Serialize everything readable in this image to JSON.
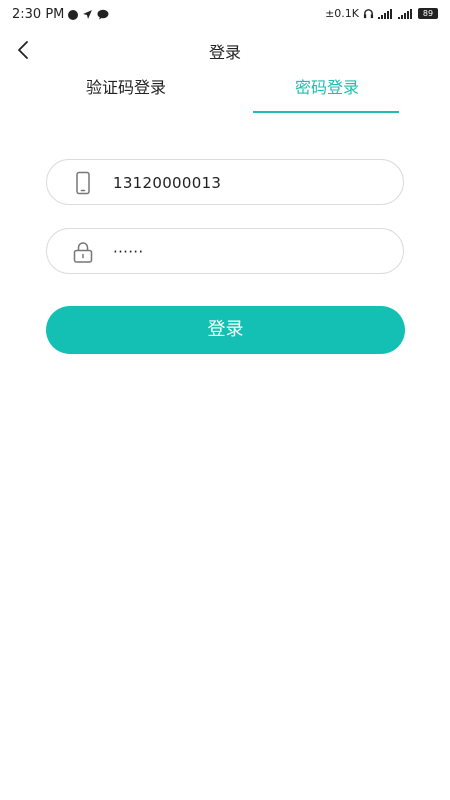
{
  "status_bar": {
    "time": "2:30 PM",
    "net_speed": "±0.1K",
    "battery": "89"
  },
  "header": {
    "title": "登录"
  },
  "tabs": [
    {
      "label": "验证码登录",
      "active": false
    },
    {
      "label": "密码登录",
      "active": true
    }
  ],
  "form": {
    "phone": {
      "value": "13120000013",
      "icon": "phone-icon"
    },
    "password": {
      "value": "······",
      "icon": "lock-icon"
    },
    "submit_label": "登录"
  },
  "colors": {
    "accent": "#1fbdb0",
    "button": "#13c0b3",
    "border": "#dcdcdc"
  }
}
